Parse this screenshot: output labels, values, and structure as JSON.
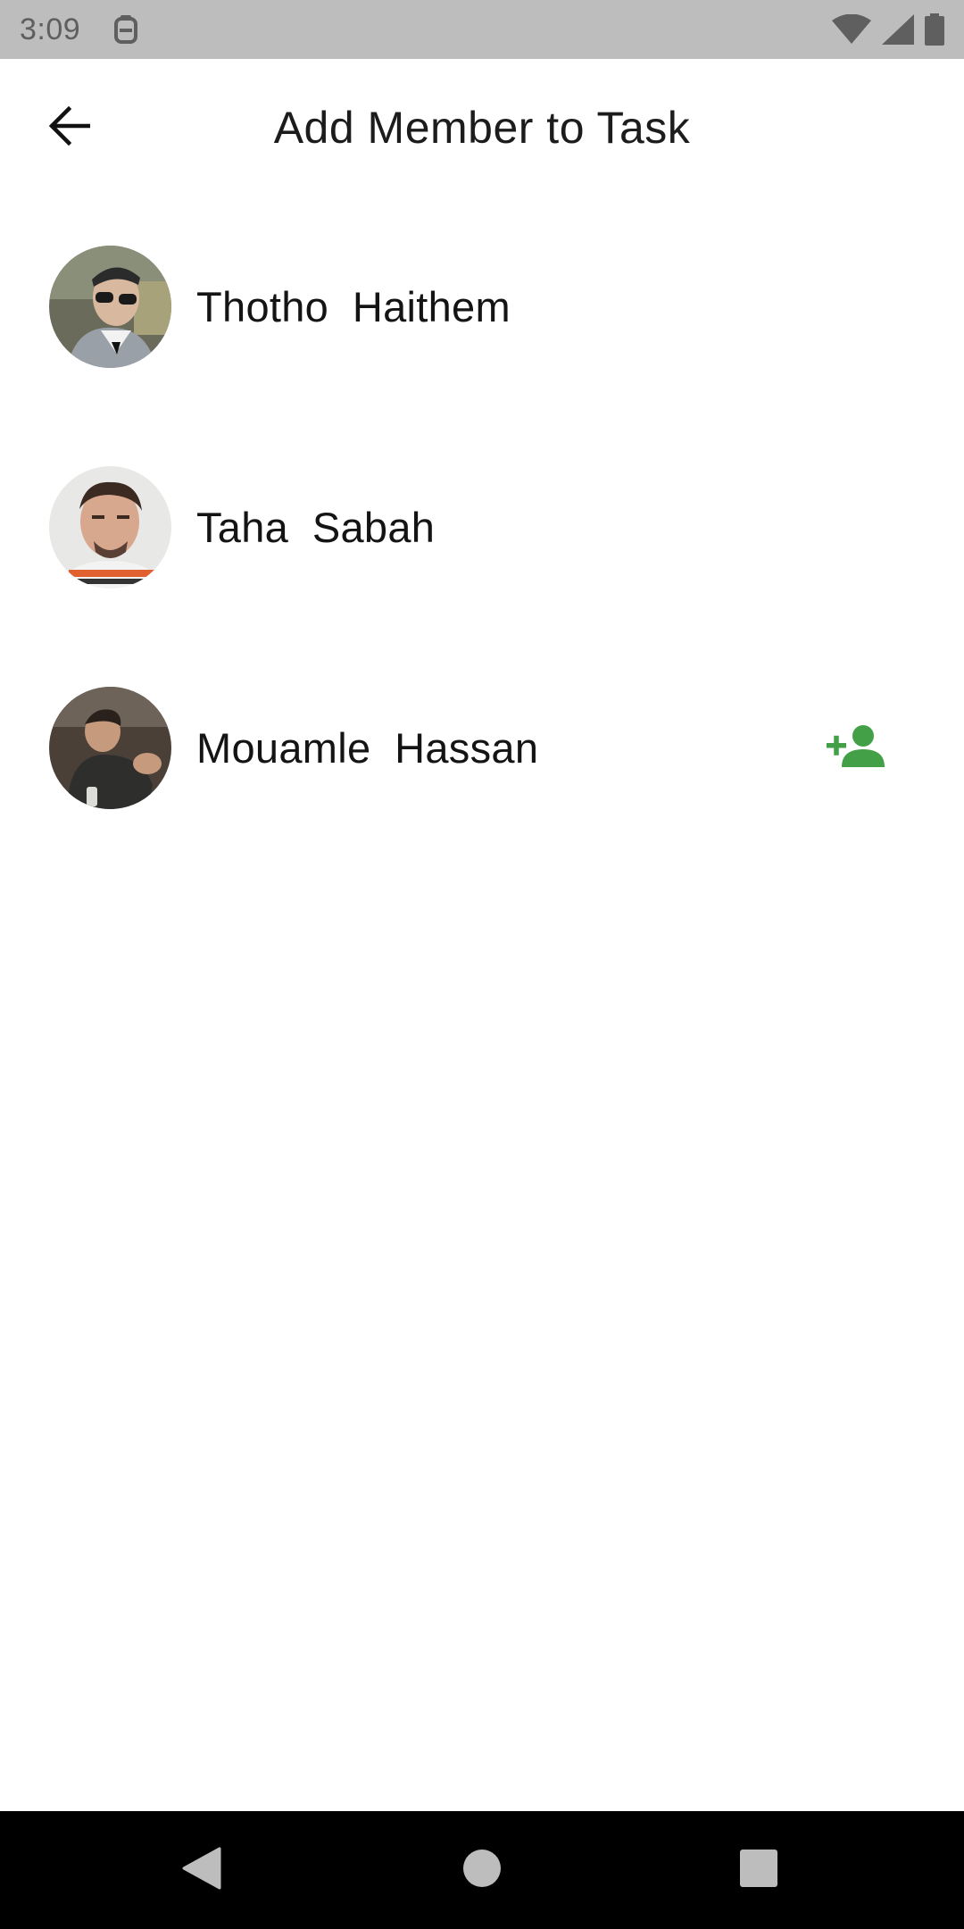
{
  "status_bar": {
    "time": "3:09",
    "notification_icon": "clipboard-notification-icon",
    "wifi_icon": "wifi-icon",
    "signal_icon": "cell-signal-icon",
    "battery_icon": "battery-icon"
  },
  "app_bar": {
    "title": "Add Member to Task",
    "back_icon": "arrow-back-icon"
  },
  "members": [
    {
      "first_name": "Thotho",
      "last_name": "Haithem",
      "display": "Thotho  Haithem",
      "has_add_action": false
    },
    {
      "first_name": "Taha",
      "last_name": "Sabah",
      "display": "Taha  Sabah",
      "has_add_action": false
    },
    {
      "first_name": "Mouamle",
      "last_name": "Hassan",
      "display": "Mouamle  Hassan",
      "has_add_action": true
    }
  ],
  "add_action": {
    "icon": "person-add-icon",
    "color": "#43a047"
  },
  "nav_bar": {
    "back_icon": "nav-back-icon",
    "home_icon": "nav-home-icon",
    "recents_icon": "nav-recents-icon"
  }
}
